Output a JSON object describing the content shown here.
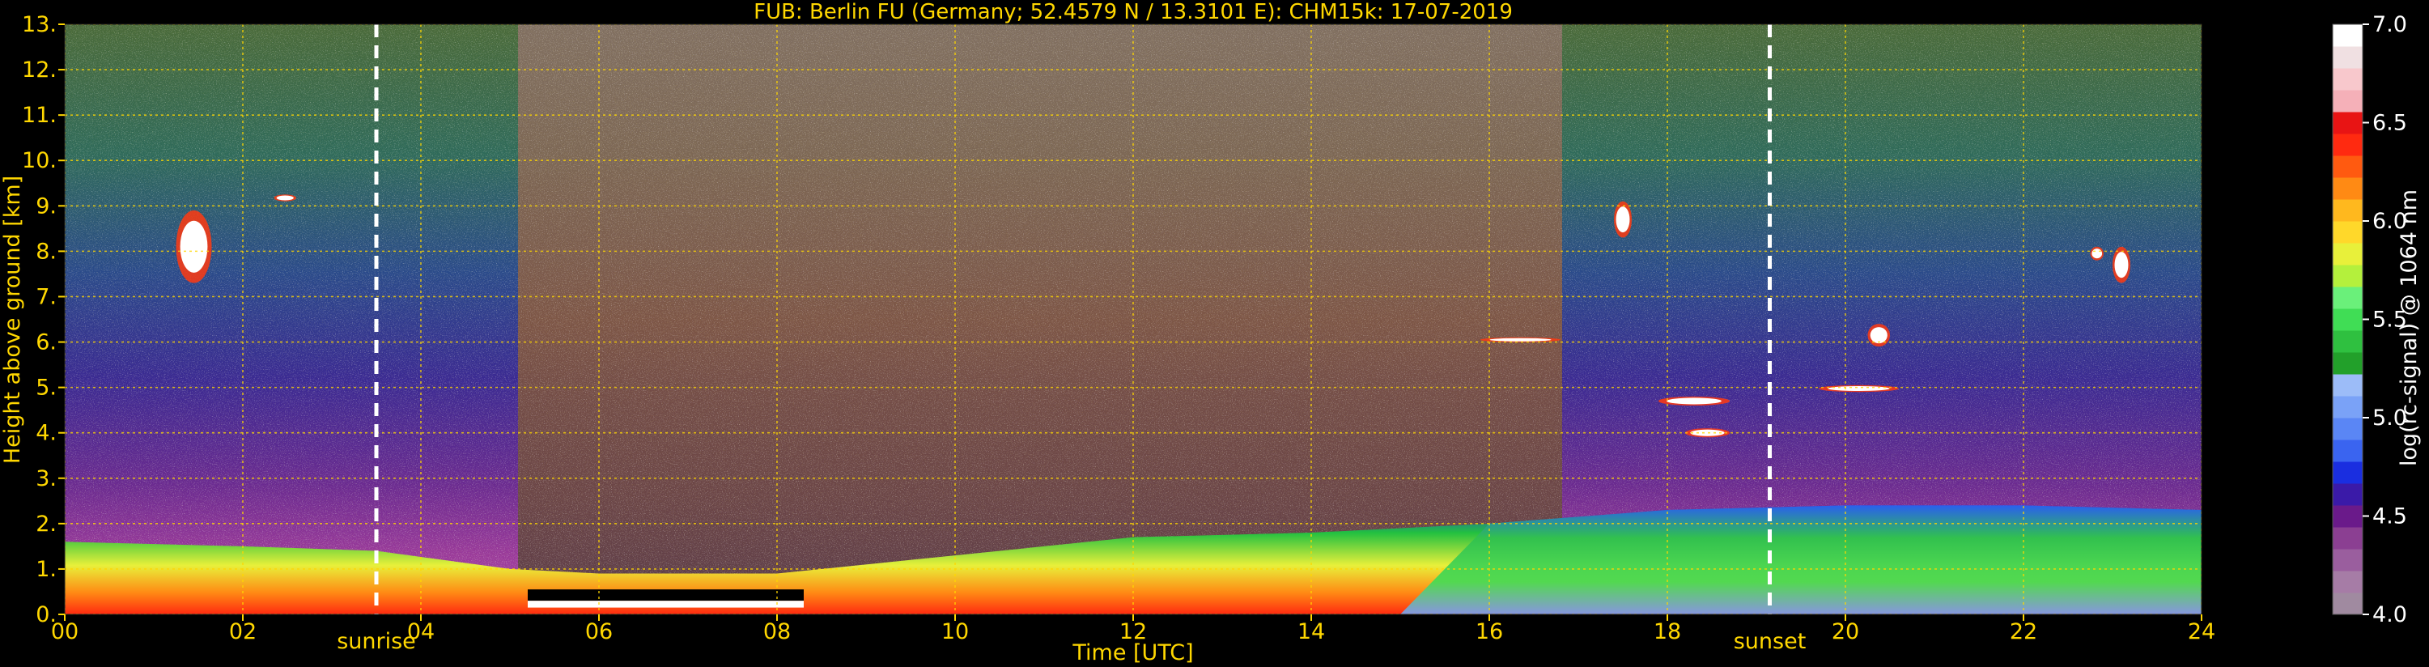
{
  "chart_data": {
    "type": "heatmap",
    "title": "FUB: Berlin FU (Germany; 52.4579 N / 13.3101 E):    CHM15k: 17-07-2019",
    "xlabel": "Time [UTC]",
    "ylabel": "Height above ground [km]",
    "xlim": [
      0,
      24
    ],
    "ylim": [
      0,
      13
    ],
    "x_ticks": [
      "00",
      "02",
      "04",
      "06",
      "08",
      "10",
      "12",
      "14",
      "16",
      "18",
      "20",
      "22",
      "24"
    ],
    "y_ticks": [
      "0.",
      "1.",
      "2.",
      "3.",
      "4.",
      "5.",
      "6.",
      "7.",
      "8.",
      "9.",
      "10.",
      "11.",
      "12.",
      "13."
    ],
    "grid": true,
    "event_markers": [
      {
        "label": "sunrise",
        "x": 3.5
      },
      {
        "label": "sunset",
        "x": 19.15
      }
    ],
    "colorbar": {
      "label": "log(rc-signal) @ 1064 nm",
      "range": [
        4.0,
        7.0
      ],
      "ticks": [
        "4.0",
        "4.5",
        "5.0",
        "5.5",
        "6.0",
        "6.5",
        "7.0"
      ],
      "colors": [
        "#a08aa0",
        "#a67ca6",
        "#9a5e9e",
        "#8b3f92",
        "#6a1a8a",
        "#3a1aa8",
        "#1a2ee0",
        "#3a64f0",
        "#5a86f5",
        "#7aa2f7",
        "#9cbcf8",
        "#22a02a",
        "#2fc040",
        "#40dd55",
        "#6af07a",
        "#b4f03c",
        "#e8f03a",
        "#ffd82a",
        "#ffb81e",
        "#ff8a14",
        "#ff5a10",
        "#ff2a10",
        "#e81414",
        "#f5b0b8",
        "#f8c8cc",
        "#f0e0e2",
        "#ffffff"
      ]
    },
    "description_layers": {
      "boundary_layer_top_km": [
        [
          0,
          1.6
        ],
        [
          2,
          1.5
        ],
        [
          3.5,
          1.4
        ],
        [
          5,
          1.0
        ],
        [
          6,
          0.9
        ],
        [
          8,
          0.9
        ],
        [
          10,
          1.3
        ],
        [
          12,
          1.7
        ],
        [
          14,
          1.8
        ],
        [
          16,
          2.0
        ],
        [
          18,
          2.3
        ],
        [
          20,
          2.4
        ],
        [
          22,
          2.4
        ],
        [
          24,
          2.3
        ]
      ],
      "clouds": [
        {
          "x": [
            1.25,
            1.65
          ],
          "y": [
            7.3,
            8.9
          ]
        },
        {
          "x": [
            2.35,
            2.6
          ],
          "y": [
            9.1,
            9.25
          ]
        },
        {
          "x": [
            15.9,
            16.8
          ],
          "y": [
            6.0,
            6.1
          ]
        },
        {
          "x": [
            17.4,
            17.6
          ],
          "y": [
            8.3,
            9.1
          ]
        },
        {
          "x": [
            17.9,
            18.7
          ],
          "y": [
            4.6,
            4.8
          ]
        },
        {
          "x": [
            18.2,
            18.7
          ],
          "y": [
            3.9,
            4.1
          ]
        },
        {
          "x": [
            19.7,
            20.6
          ],
          "y": [
            4.9,
            5.05
          ]
        },
        {
          "x": [
            20.25,
            20.5
          ],
          "y": [
            5.9,
            6.4
          ]
        },
        {
          "x": [
            22.75,
            22.9
          ],
          "y": [
            7.8,
            8.1
          ]
        },
        {
          "x": [
            23.0,
            23.2
          ],
          "y": [
            7.3,
            8.1
          ]
        }
      ]
    }
  }
}
